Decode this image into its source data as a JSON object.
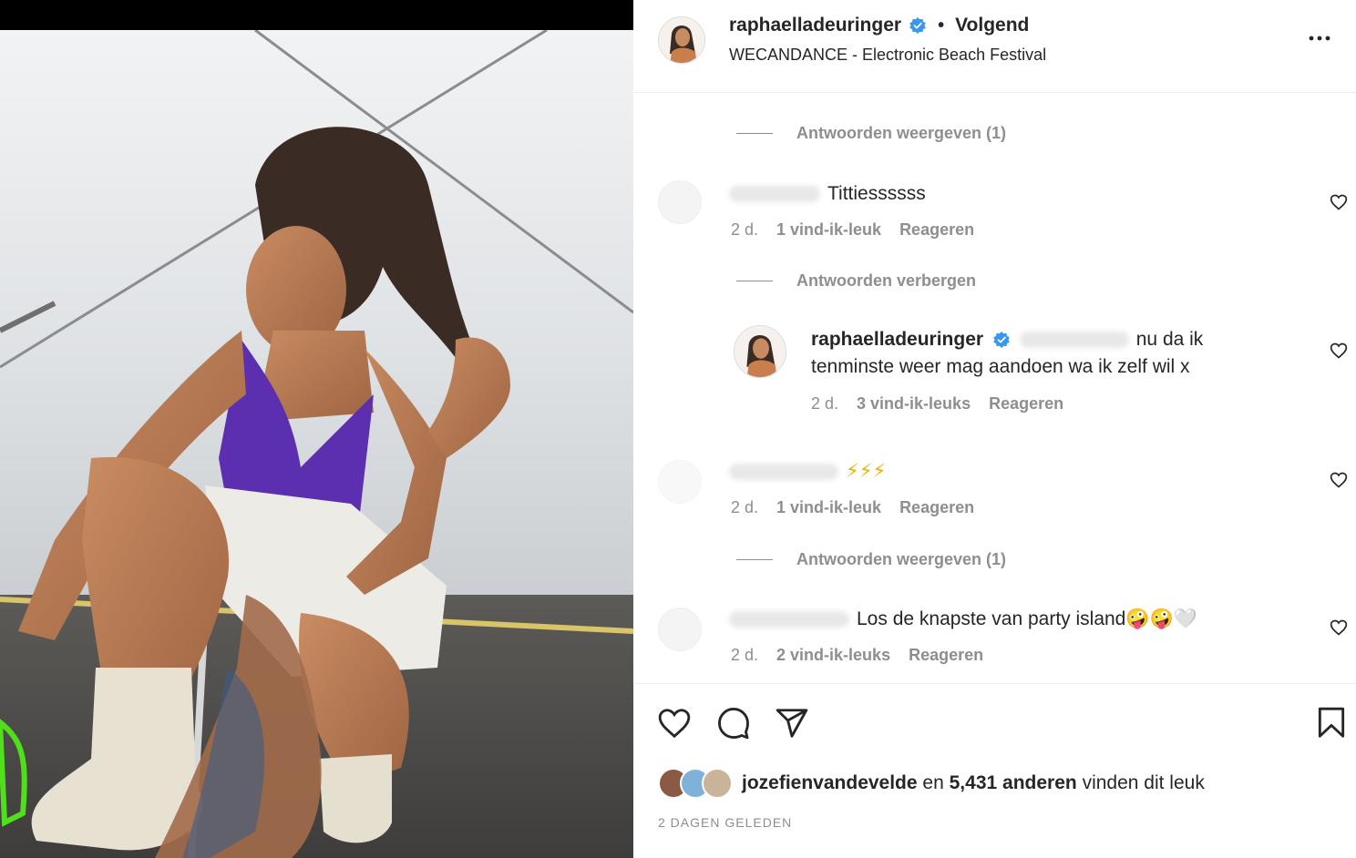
{
  "post": {
    "username": "raphaelladeuringer",
    "follow_status": "Volgend",
    "separator": "•",
    "location": "WECANDANCE - Electronic Beach Festival"
  },
  "comments": {
    "toggle_1": "Antwoorden weergeven (1)",
    "c1": {
      "text": "Tittiessssss",
      "time": "2 d.",
      "likes": "1 vind-ik-leuk",
      "reply": "Reageren"
    },
    "toggle_2": "Antwoorden verbergen",
    "r1": {
      "username": "raphaelladeuringer",
      "text_line1": "nu da ik",
      "text_line2": "tenminste weer mag aandoen wa ik zelf wil x",
      "time": "2 d.",
      "likes": "3 vind-ik-leuks",
      "reply": "Reageren"
    },
    "c2": {
      "text": "⚡⚡⚡",
      "time": "2 d.",
      "likes": "1 vind-ik-leuk",
      "reply": "Reageren"
    },
    "toggle_3": "Antwoorden weergeven (1)",
    "c3": {
      "text": "Los de knapste van party island🤪🤪🤍",
      "time": "2 d.",
      "likes": "2 vind-ik-leuks",
      "reply": "Reageren"
    }
  },
  "likes": {
    "first_liker": "jozefienvandevelde",
    "connector": "en",
    "others_count": "5,431 anderen",
    "suffix": "vinden dit leuk"
  },
  "timestamp": "2 DAGEN GELEDEN",
  "icons": {
    "verified": "verified-badge-icon",
    "more": "more-options-icon",
    "heart": "heart-icon",
    "comment": "comment-icon",
    "share": "share-icon",
    "save": "bookmark-icon"
  },
  "colors": {
    "verified_blue": "#3897f0",
    "meta_gray": "#8e8e8e",
    "text_dark": "#262626",
    "top_purple": "#5b2fb0"
  }
}
